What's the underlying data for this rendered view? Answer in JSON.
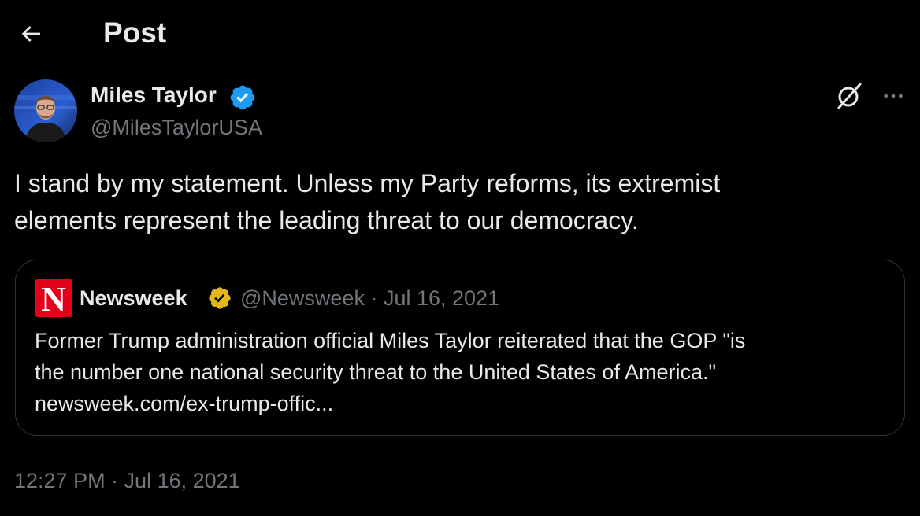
{
  "header": {
    "title": "Post",
    "back_icon": "arrow-left-icon"
  },
  "author": {
    "name": "Miles Taylor",
    "handle": "@MilesTaylorUSA",
    "verified_color": "#1d9bf0"
  },
  "post": {
    "text": "I stand by my statement. Unless my Party reforms, its extremist\nelements represent the leading threat to our democracy.",
    "timestamp": "12:27 PM · Jul 16, 2021"
  },
  "quote": {
    "logo_letter": "N",
    "logo_color": "#e3001b",
    "name": "Newsweek",
    "verified_color": "#e2b719",
    "meta": "@Newsweek · Jul 16, 2021",
    "text": "Former Trump administration official Miles Taylor reiterated that the GOP \"is\nthe number one national security threat to the United States of America.\"\nnewsweek.com/ex-trump-offic..."
  },
  "actions": {
    "grok_icon": "grok-icon",
    "more_icon": "more-dots-icon"
  },
  "colors": {
    "background": "#000000",
    "text_primary": "#e7e9ea",
    "text_secondary": "#71767b",
    "border": "#2f3336"
  }
}
